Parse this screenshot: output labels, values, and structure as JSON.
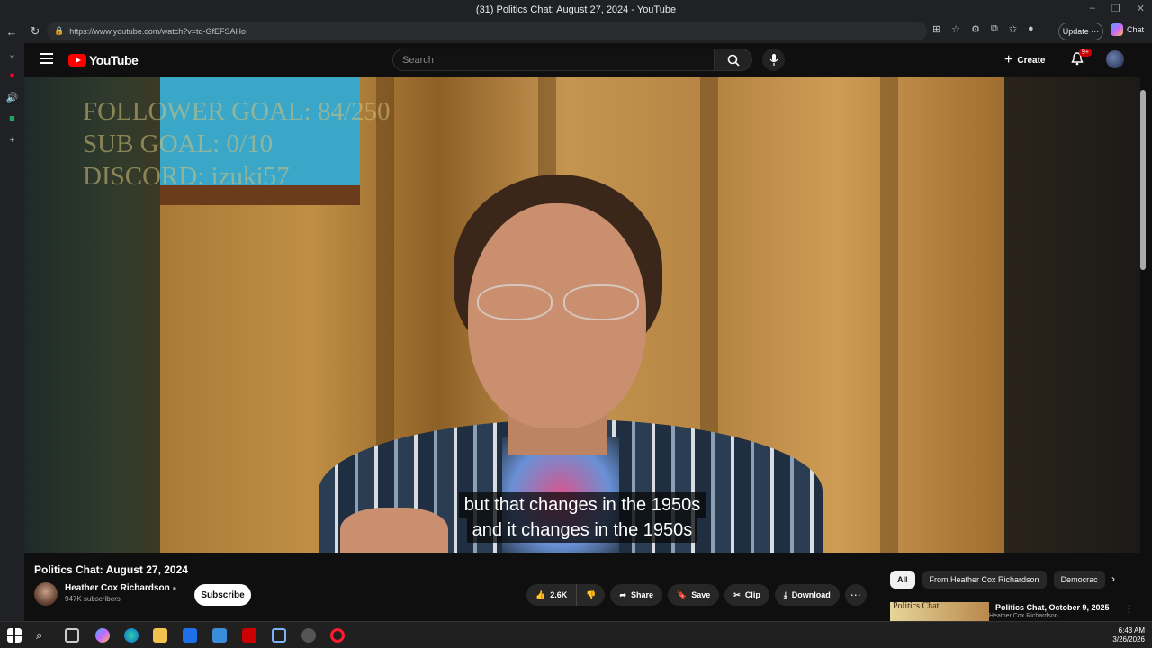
{
  "browser": {
    "tab_title": "(31) Politics Chat: August 27, 2024 - YouTube",
    "url": "https://www.youtube.com/watch?v=tq-GfEFSAHo",
    "update_label": "Update",
    "chat_label": "Chat"
  },
  "youtube": {
    "logo_text": "YouTube",
    "search_placeholder": "Search",
    "create_label": "Create",
    "notification_count": "9+"
  },
  "video": {
    "overlay_lines": [
      "FOLLOWER GOAL:  84/250",
      "SUB GOAL: 0/10",
      "DISCORD: izuki57"
    ],
    "subtitles": [
      "but that changes in the 1950s",
      "and it changes in the 1950s"
    ],
    "title": "Politics Chat: August 27, 2024"
  },
  "channel": {
    "name": "Heather Cox Richardson",
    "subscribers": "947K subscribers",
    "subscribe_label": "Subscribe"
  },
  "actions": {
    "likes": "2.6K",
    "share": "Share",
    "save": "Save",
    "clip": "Clip",
    "download": "Download"
  },
  "chips": [
    "All",
    "From Heather Cox Richardson",
    "Democrac"
  ],
  "recommendation": {
    "title": "Politics Chat, October 9, 2025",
    "channel": "Heather Cox Richardson",
    "thumb_text": "Politics Chat"
  },
  "taskbar": {
    "time": "6:43 AM",
    "date": "3/26/2026"
  }
}
